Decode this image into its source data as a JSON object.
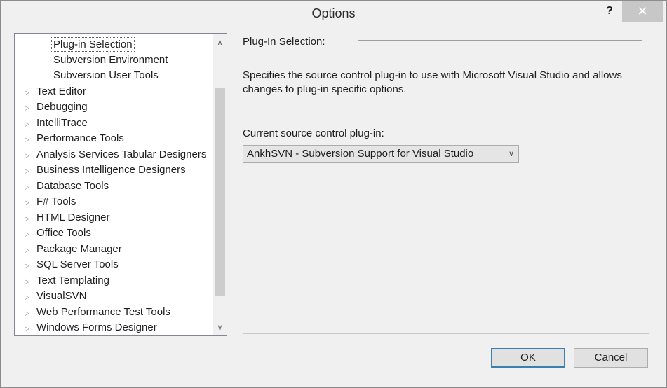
{
  "window": {
    "title": "Options",
    "help_label": "?",
    "close_label": "✕"
  },
  "tree": {
    "items": [
      {
        "label": "Plug-in Selection",
        "level": 1,
        "expandable": false,
        "selected": true
      },
      {
        "label": "Subversion Environment",
        "level": 1,
        "expandable": false
      },
      {
        "label": "Subversion User Tools",
        "level": 1,
        "expandable": false
      },
      {
        "label": "Text Editor",
        "level": 0,
        "expandable": true
      },
      {
        "label": "Debugging",
        "level": 0,
        "expandable": true
      },
      {
        "label": "IntelliTrace",
        "level": 0,
        "expandable": true
      },
      {
        "label": "Performance Tools",
        "level": 0,
        "expandable": true
      },
      {
        "label": "Analysis Services Tabular Designers",
        "level": 0,
        "expandable": true
      },
      {
        "label": "Business Intelligence Designers",
        "level": 0,
        "expandable": true
      },
      {
        "label": "Database Tools",
        "level": 0,
        "expandable": true
      },
      {
        "label": "F# Tools",
        "level": 0,
        "expandable": true
      },
      {
        "label": "HTML Designer",
        "level": 0,
        "expandable": true
      },
      {
        "label": "Office Tools",
        "level": 0,
        "expandable": true
      },
      {
        "label": "Package Manager",
        "level": 0,
        "expandable": true
      },
      {
        "label": "SQL Server Tools",
        "level": 0,
        "expandable": true
      },
      {
        "label": "Text Templating",
        "level": 0,
        "expandable": true
      },
      {
        "label": "VisualSVN",
        "level": 0,
        "expandable": true
      },
      {
        "label": "Web Performance Test Tools",
        "level": 0,
        "expandable": true
      },
      {
        "label": "Windows Forms Designer",
        "level": 0,
        "expandable": true
      }
    ],
    "scroll_up_icon": "chevron-up-icon",
    "scroll_down_icon": "chevron-down-icon"
  },
  "pane": {
    "heading": "Plug-In Selection:",
    "description": "Specifies the source control plug-in to use with Microsoft Visual Studio and allows changes to plug-in specific options.",
    "plugin_label": "Current source control plug-in:",
    "plugin_value": "AnkhSVN - Subversion Support for Visual Studio"
  },
  "buttons": {
    "ok": "OK",
    "cancel": "Cancel"
  },
  "colors": {
    "ok_border": "#3c7fb1",
    "close_bg": "#c7c7c7"
  }
}
